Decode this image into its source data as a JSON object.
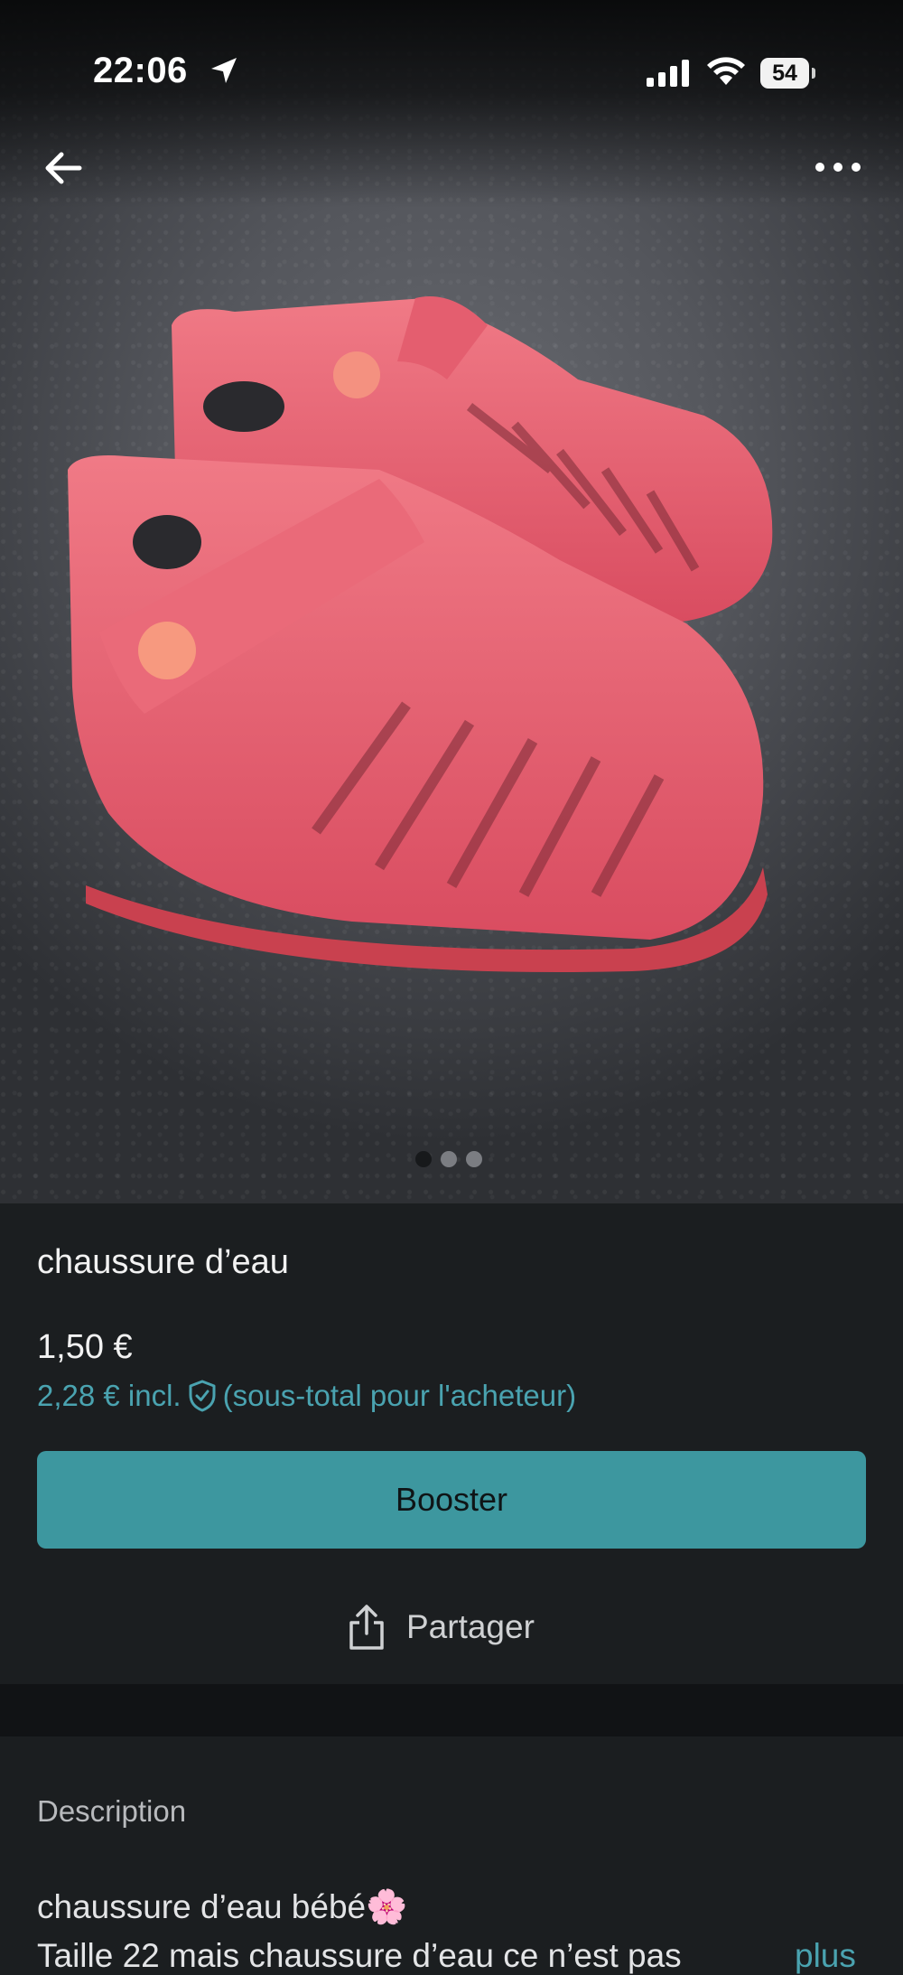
{
  "status_bar": {
    "time": "22:06",
    "battery": "54"
  },
  "gallery": {
    "image": "pink-jelly-sandals-photo",
    "slide_count": 3,
    "active_slide": 1
  },
  "product": {
    "title": "chaussure d’eau",
    "price": "1,50 €",
    "price_incl": "2,28 € incl.",
    "price_incl_note": "(sous-total pour l'acheteur)"
  },
  "actions": {
    "boost_label": "Booster",
    "share_label": "Partager"
  },
  "description": {
    "label": "Description",
    "line1": "chaussure d’eau bébé🌸",
    "line2": "Taille 22 mais chaussure d’eau ce n’est pas",
    "more_label": "plus"
  },
  "icons": [
    "location-arrow-icon",
    "signal-icon",
    "wifi-icon",
    "back-arrow-icon",
    "more-dots-icon",
    "shield-check-icon",
    "share-icon"
  ],
  "colors": {
    "accent": "#3d979f",
    "link": "#4aa3b0",
    "background": "#1b1e20",
    "product": "#e8596a"
  }
}
